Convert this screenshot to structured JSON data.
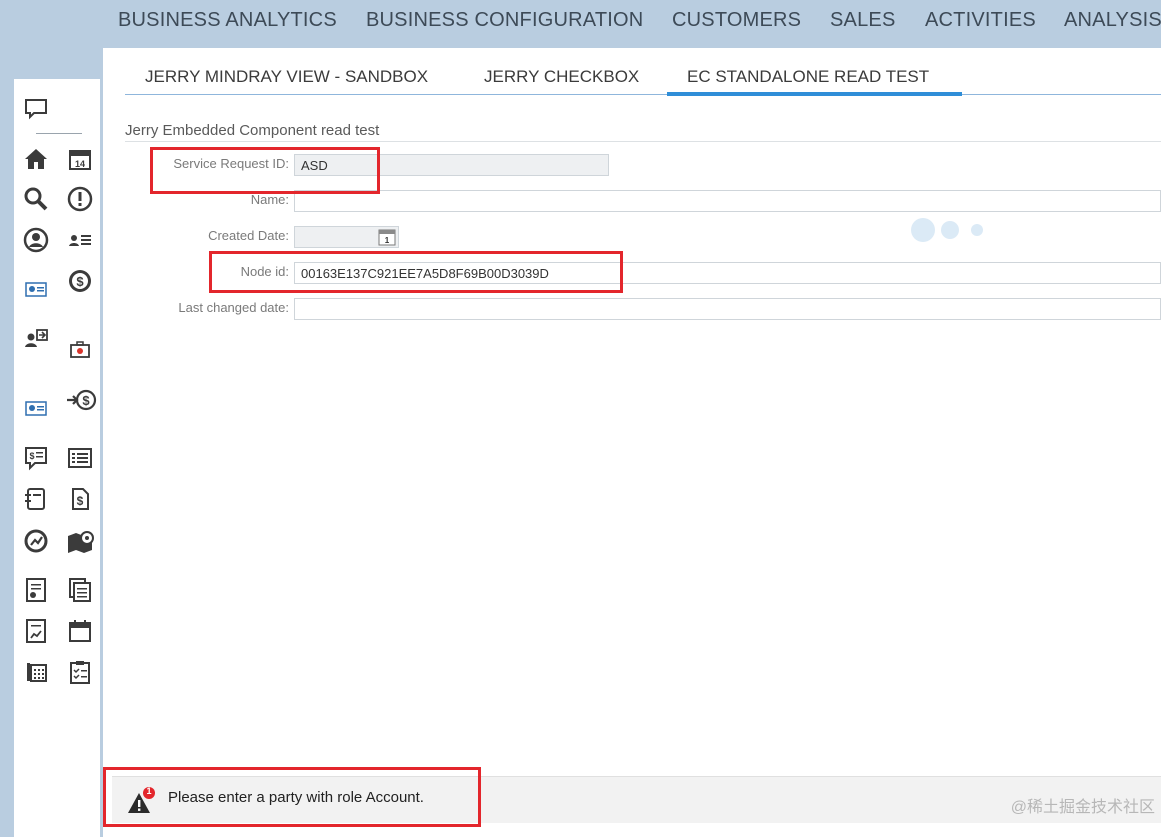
{
  "top_nav": {
    "items": [
      "BUSINESS ANALYTICS",
      "BUSINESS CONFIGURATION",
      "CUSTOMERS",
      "SALES",
      "ACTIVITIES",
      "ANALYSIS"
    ]
  },
  "tabs": {
    "items": [
      "JERRY MINDRAY VIEW - SANDBOX",
      "JERRY CHECKBOX",
      "EC STANDALONE READ TEST"
    ],
    "active": "EC STANDALONE READ TEST"
  },
  "form": {
    "title": "Jerry Embedded Component read test",
    "service_request_id_label": "Service Request ID:",
    "service_request_id_value": "ASD",
    "name_label": "Name:",
    "name_value": "",
    "created_date_label": "Created Date:",
    "created_date_value": "",
    "node_id_label": "Node id:",
    "node_id_value": "00163E137C921EE7A5D8F69B00D3039D",
    "last_changed_label": "Last changed date:",
    "last_changed_value": ""
  },
  "message": {
    "count": "1",
    "text": "Please enter a party with role Account."
  },
  "watermark": "@稀土掘金技术社区",
  "sidebar": {
    "icons": [
      "chat-icon",
      "home-icon",
      "calendar-icon",
      "search-icon",
      "alert-icon",
      "person-icon",
      "contacts-list-icon",
      "id-card-icon",
      "dollar-icon",
      "person-transfer-icon",
      "briefcase-icon",
      "id-card-icon",
      "transfer-dollar-icon",
      "quote-icon",
      "list-icon",
      "document-icon",
      "dollar-document-icon",
      "chart-cycle-icon",
      "map-pin-icon",
      "report-icon",
      "pages-icon",
      "report-chart-icon",
      "calendar-plain-icon",
      "phone-icon",
      "clipboard-icon"
    ]
  },
  "colors": {
    "accent": "#2f8ed8",
    "highlight_box": "#e3262c",
    "nav_background": "#b9cde0"
  }
}
